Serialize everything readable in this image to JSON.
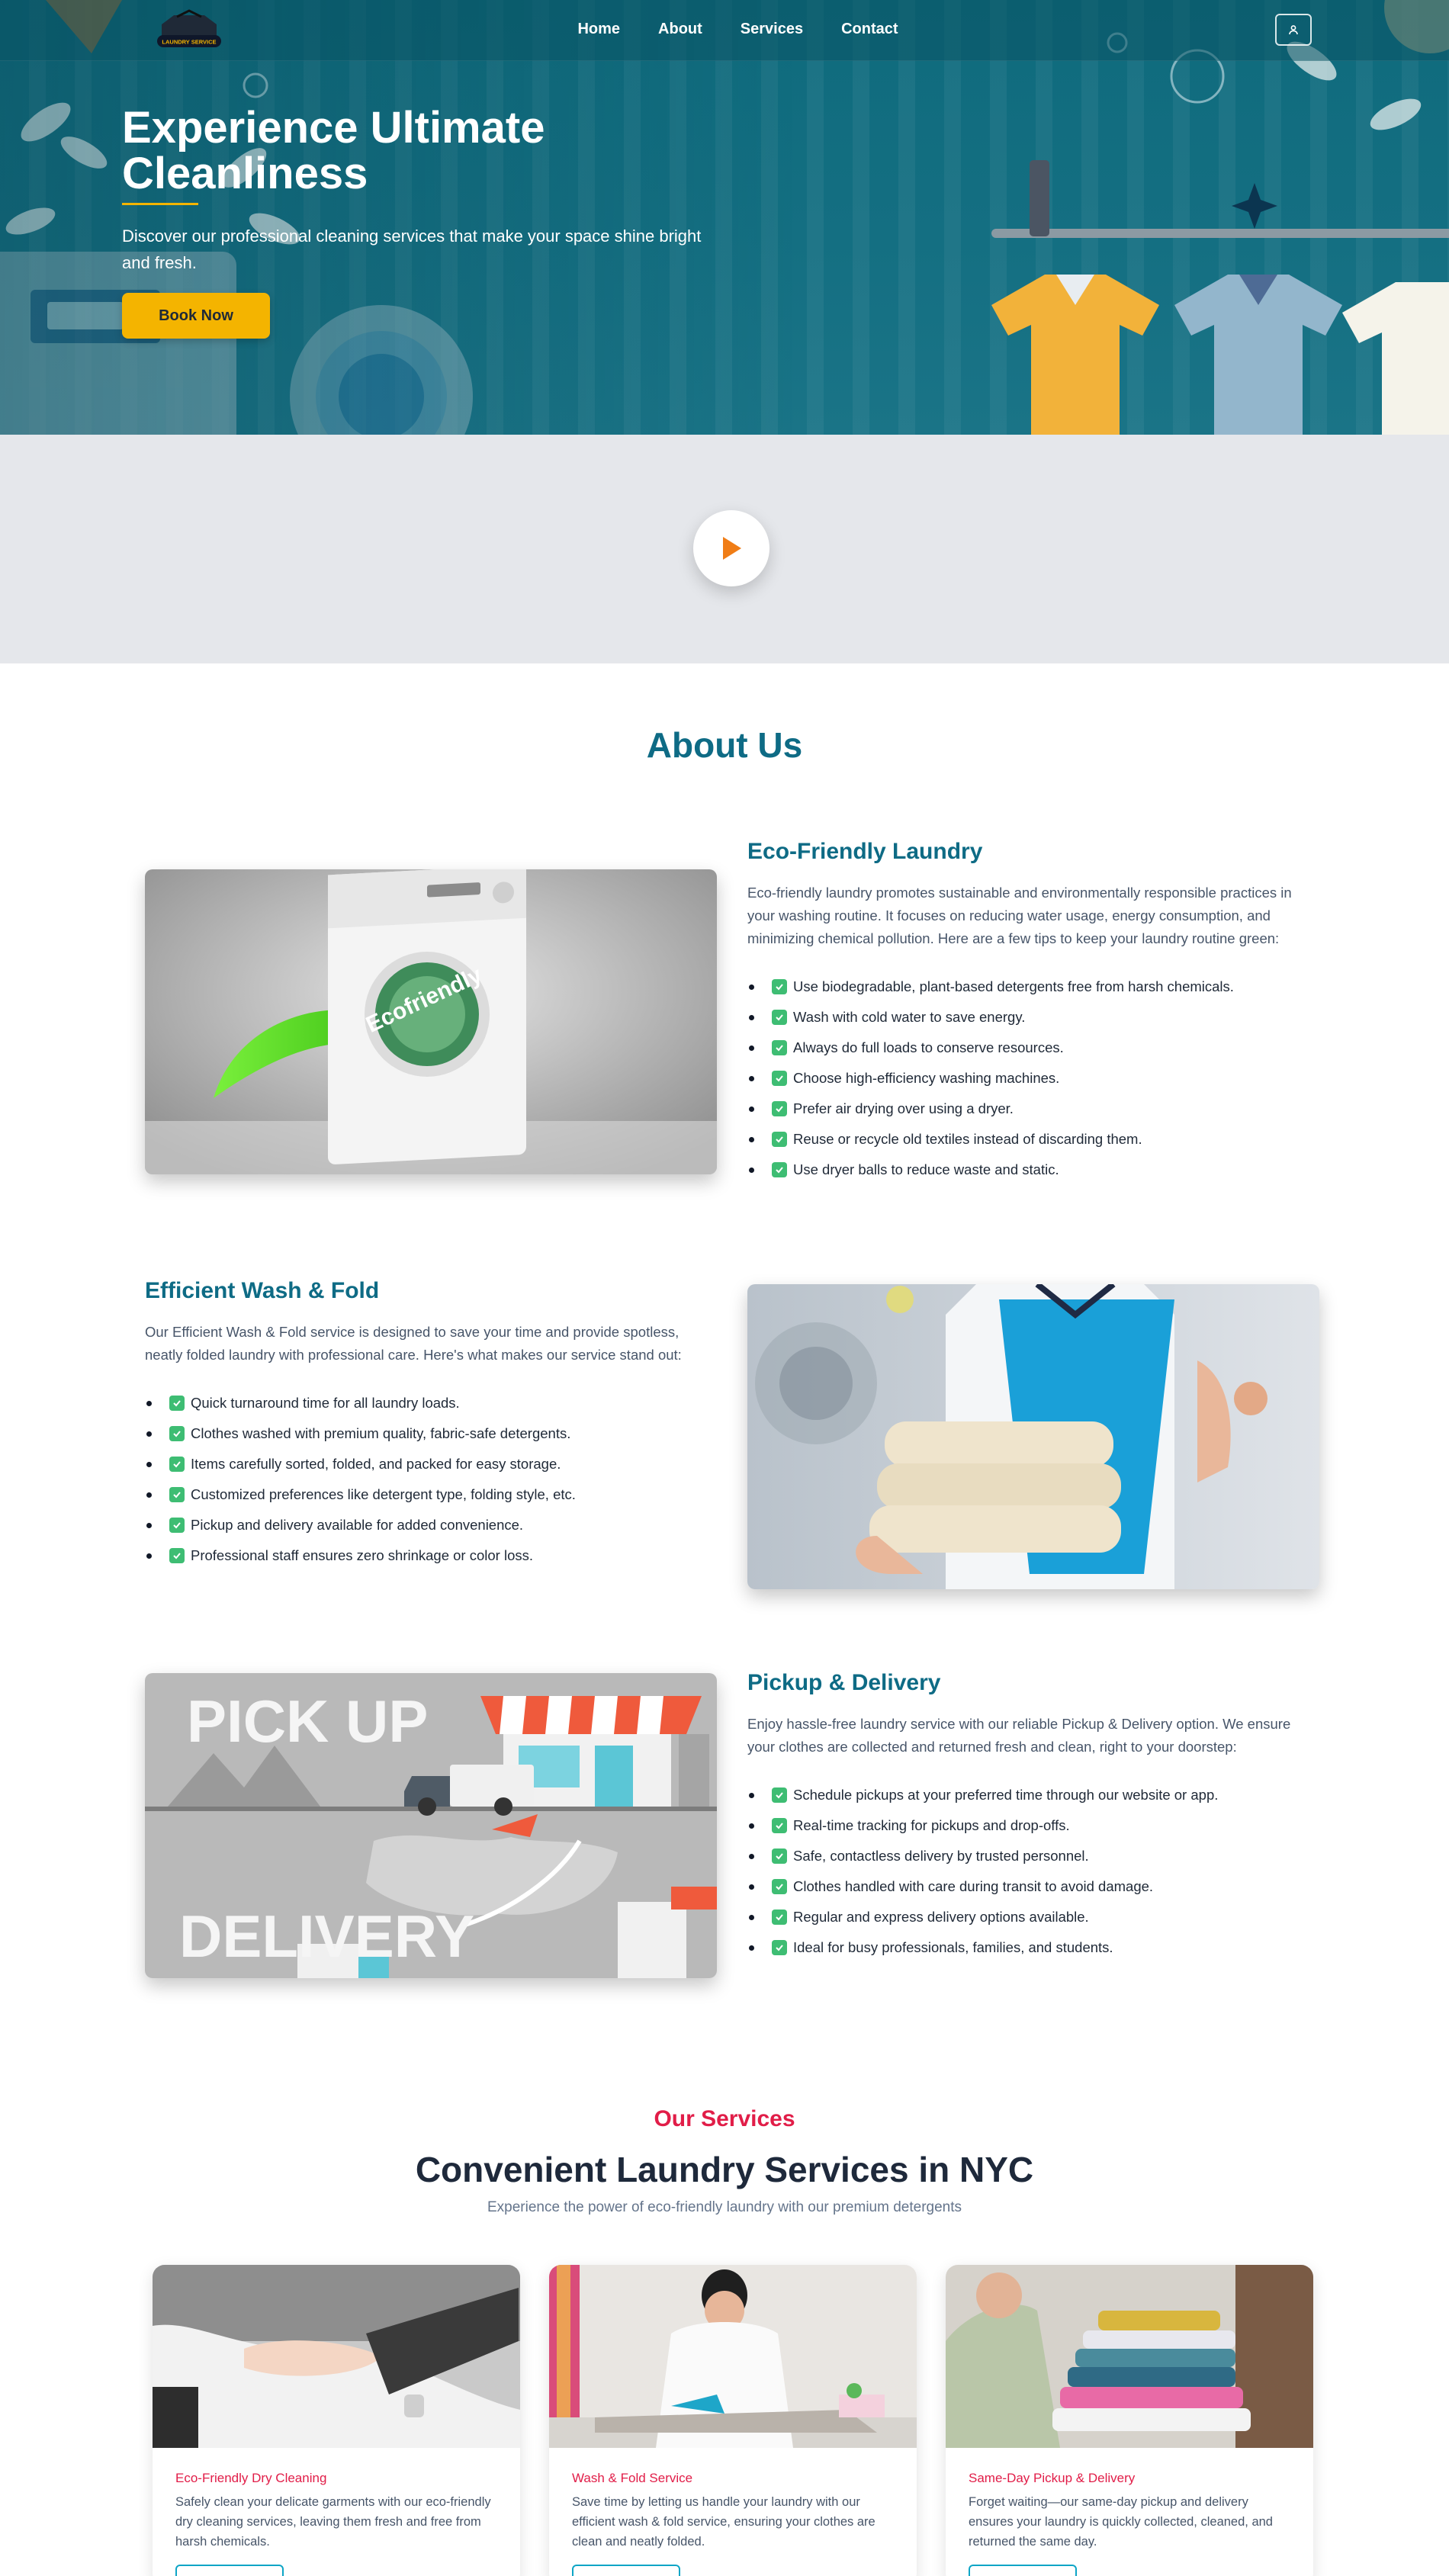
{
  "colors": {
    "brand_teal": "#0e6b85",
    "accent_yellow": "#f4b400",
    "accent_red": "#e11d48",
    "check_green": "#3ebd73",
    "play_orange": "#f07d16"
  },
  "nav": {
    "logo_text": "LAUNDRY SERVICE",
    "links": [
      "Home",
      "About",
      "Services",
      "Contact"
    ],
    "user_icon": "user-icon"
  },
  "hero": {
    "title": "Experience Ultimate Cleanliness",
    "subtitle": "Discover our professional cleaning services that make your space shine bright and fresh.",
    "cta": "Book Now"
  },
  "video": {
    "play_icon": "play-icon"
  },
  "about": {
    "title": "About Us",
    "sections": [
      {
        "heading": "Eco-Friendly Laundry",
        "description": "Eco-friendly laundry promotes sustainable and environmentally responsible practices in your washing routine. It focuses on reducing water usage, energy consumption, and minimizing chemical pollution. Here are a few tips to keep your laundry routine green:",
        "image_label": "Ecofriendly",
        "items": [
          "Use biodegradable, plant-based detergents free from harsh chemicals.",
          "Wash with cold water to save energy.",
          "Always do full loads to conserve resources.",
          "Choose high-efficiency washing machines.",
          "Prefer air drying over using a dryer.",
          "Reuse or recycle old textiles instead of discarding them.",
          "Use dryer balls to reduce waste and static."
        ]
      },
      {
        "heading": "Efficient Wash & Fold",
        "description": "Our Efficient Wash & Fold service is designed to save your time and provide spotless, neatly folded laundry with professional care. Here's what makes our service stand out:",
        "items": [
          "Quick turnaround time for all laundry loads.",
          "Clothes washed with premium quality, fabric-safe detergents.",
          "Items carefully sorted, folded, and packed for easy storage.",
          "Customized preferences like detergent type, folding style, etc.",
          "Pickup and delivery available for added convenience.",
          "Professional staff ensures zero shrinkage or color loss."
        ]
      },
      {
        "heading": "Pickup & Delivery",
        "description": "Enjoy hassle-free laundry service with our reliable Pickup & Delivery option. We ensure your clothes are collected and returned fresh and clean, right to your doorstep:",
        "image_label_top": "PICK UP",
        "image_label_bottom": "DELIVERY",
        "items": [
          "Schedule pickups at your preferred time through our website or app.",
          "Real-time tracking for pickups and drop-offs.",
          "Safe, contactless delivery by trusted personnel.",
          "Clothes handled with care during transit to avoid damage.",
          "Regular and express delivery options available.",
          "Ideal for busy professionals, families, and students."
        ]
      }
    ]
  },
  "services": {
    "eyebrow": "Our Services",
    "title": "Convenient Laundry Services in NYC",
    "subtitle": "Experience the power of eco-friendly laundry with our premium detergents",
    "cards": [
      {
        "title": "Eco-Friendly Dry Cleaning",
        "text": "Safely clean your delicate garments with our eco-friendly dry cleaning services, leaving them fresh and free from harsh chemicals."
      },
      {
        "title": "Wash & Fold Service",
        "text": "Save time by letting us handle your laundry with our efficient wash & fold service, ensuring your clothes are clean and neatly folded."
      },
      {
        "title": "Same-Day Pickup & Delivery",
        "text": "Forget waiting—our same-day pickup and delivery ensures your laundry is quickly collected, cleaned, and returned the same day."
      }
    ]
  }
}
